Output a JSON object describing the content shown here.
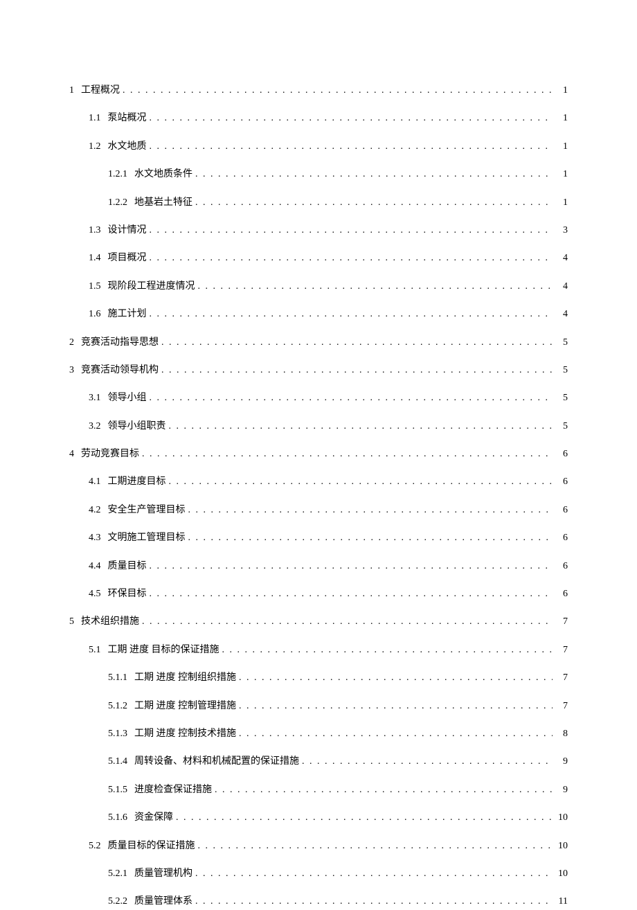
{
  "toc": [
    {
      "level": 1,
      "number": "1",
      "title": "工程概况",
      "page": "1"
    },
    {
      "level": 2,
      "number": "1.1",
      "title": "泵站概况",
      "page": "1"
    },
    {
      "level": 2,
      "number": "1.2",
      "title": "水文地质",
      "page": "1"
    },
    {
      "level": 3,
      "number": "1.2.1",
      "title": "水文地质条件",
      "page": "1"
    },
    {
      "level": 3,
      "number": "1.2.2",
      "title": "地基岩土特征",
      "page": "1"
    },
    {
      "level": 2,
      "number": "1.3",
      "title": "设计情况",
      "page": "3"
    },
    {
      "level": 2,
      "number": "1.4",
      "title": "项目概况",
      "page": "4"
    },
    {
      "level": 2,
      "number": "1.5",
      "title": "现阶段工程进度情况",
      "page": "4"
    },
    {
      "level": 2,
      "number": "1.6",
      "title": "施工计划",
      "page": "4"
    },
    {
      "level": 1,
      "number": "2",
      "title": "竞赛活动指导思想",
      "page": "5"
    },
    {
      "level": 1,
      "number": "3",
      "title": "竞赛活动领导机构",
      "page": "5"
    },
    {
      "level": 2,
      "number": "3.1",
      "title": "领导小组",
      "page": "5"
    },
    {
      "level": 2,
      "number": "3.2",
      "title": "领导小组职责",
      "page": "5"
    },
    {
      "level": 1,
      "number": "4",
      "title": "劳动竞赛目标",
      "page": "6"
    },
    {
      "level": 2,
      "number": "4.1",
      "title": "工期进度目标",
      "page": "6"
    },
    {
      "level": 2,
      "number": "4.2",
      "title": "安全生产管理目标",
      "page": "6"
    },
    {
      "level": 2,
      "number": "4.3",
      "title": "文明施工管理目标",
      "page": "6"
    },
    {
      "level": 2,
      "number": "4.4",
      "title": "质量目标",
      "page": "6"
    },
    {
      "level": 2,
      "number": "4.5",
      "title": "环保目标",
      "page": "6"
    },
    {
      "level": 1,
      "number": "5",
      "title": "技术组织措施",
      "page": "7"
    },
    {
      "level": 2,
      "number": "5.1",
      "title": "工期  进度  目标的保证措施",
      "page": "7"
    },
    {
      "level": 3,
      "number": "5.1.1",
      "title": "工期  进度  控制组织措施",
      "page": "7"
    },
    {
      "level": 3,
      "number": "5.1.2",
      "title": "工期  进度  控制管理措施",
      "page": "7"
    },
    {
      "level": 3,
      "number": "5.1.3",
      "title": "工期  进度  控制技术措施",
      "page": "8"
    },
    {
      "level": 3,
      "number": "5.1.4",
      "title": "周转设备、材料和机械配置的保证措施",
      "page": "9"
    },
    {
      "level": 3,
      "number": "5.1.5",
      "title": "进度检查保证措施",
      "page": "9"
    },
    {
      "level": 3,
      "number": "5.1.6",
      "title": "资金保障",
      "page": "10"
    },
    {
      "level": 2,
      "number": "5.2",
      "title": "质量目标的保证措施",
      "page": "10"
    },
    {
      "level": 3,
      "number": "5.2.1",
      "title": "质量管理机构",
      "page": "10"
    },
    {
      "level": 3,
      "number": "5.2.2",
      "title": "质量管理体系",
      "page": "11"
    }
  ]
}
